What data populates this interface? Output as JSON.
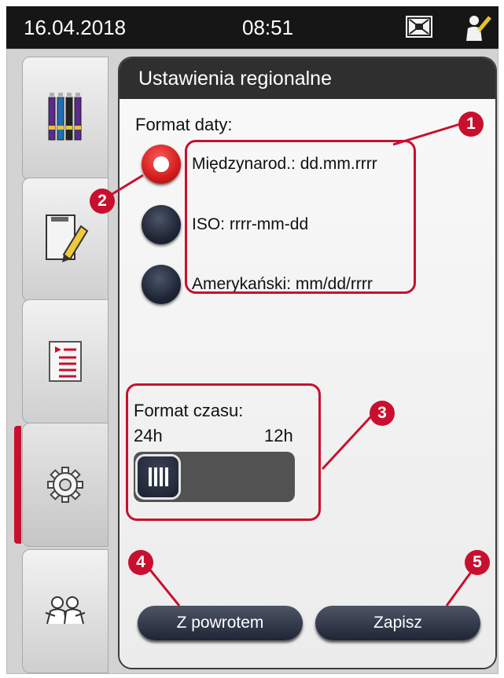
{
  "status": {
    "date": "16.04.2018",
    "time": "08:51",
    "alarm_icon": "alarm-muted-icon",
    "user_icon": "user-supervisor-icon"
  },
  "sidebar": {
    "items": [
      {
        "icon": "reagents-icon",
        "active": false
      },
      {
        "icon": "program-edit-icon",
        "active": false
      },
      {
        "icon": "protocol-list-icon",
        "active": false
      },
      {
        "icon": "settings-gear-icon",
        "active": true
      },
      {
        "icon": "user-icon",
        "active": false
      }
    ]
  },
  "panel": {
    "title": "Ustawienia regionalne",
    "date_format": {
      "label": "Format daty:",
      "options": [
        {
          "text": "Międzynarod.: dd.mm.rrrr",
          "selected": true
        },
        {
          "text": "ISO: rrrr-mm-dd",
          "selected": false
        },
        {
          "text": "Amerykański: mm/dd/rrrr",
          "selected": false
        }
      ]
    },
    "time_format": {
      "label": "Format czasu:",
      "left": "24h",
      "right": "12h",
      "selected": "24h"
    },
    "back_label": "Z powrotem",
    "save_label": "Zapisz"
  },
  "callouts": [
    "1",
    "2",
    "3",
    "4",
    "5"
  ],
  "colors": {
    "accent": "#c8102e",
    "header": "#2f2f2f",
    "button": "#1f2535"
  }
}
